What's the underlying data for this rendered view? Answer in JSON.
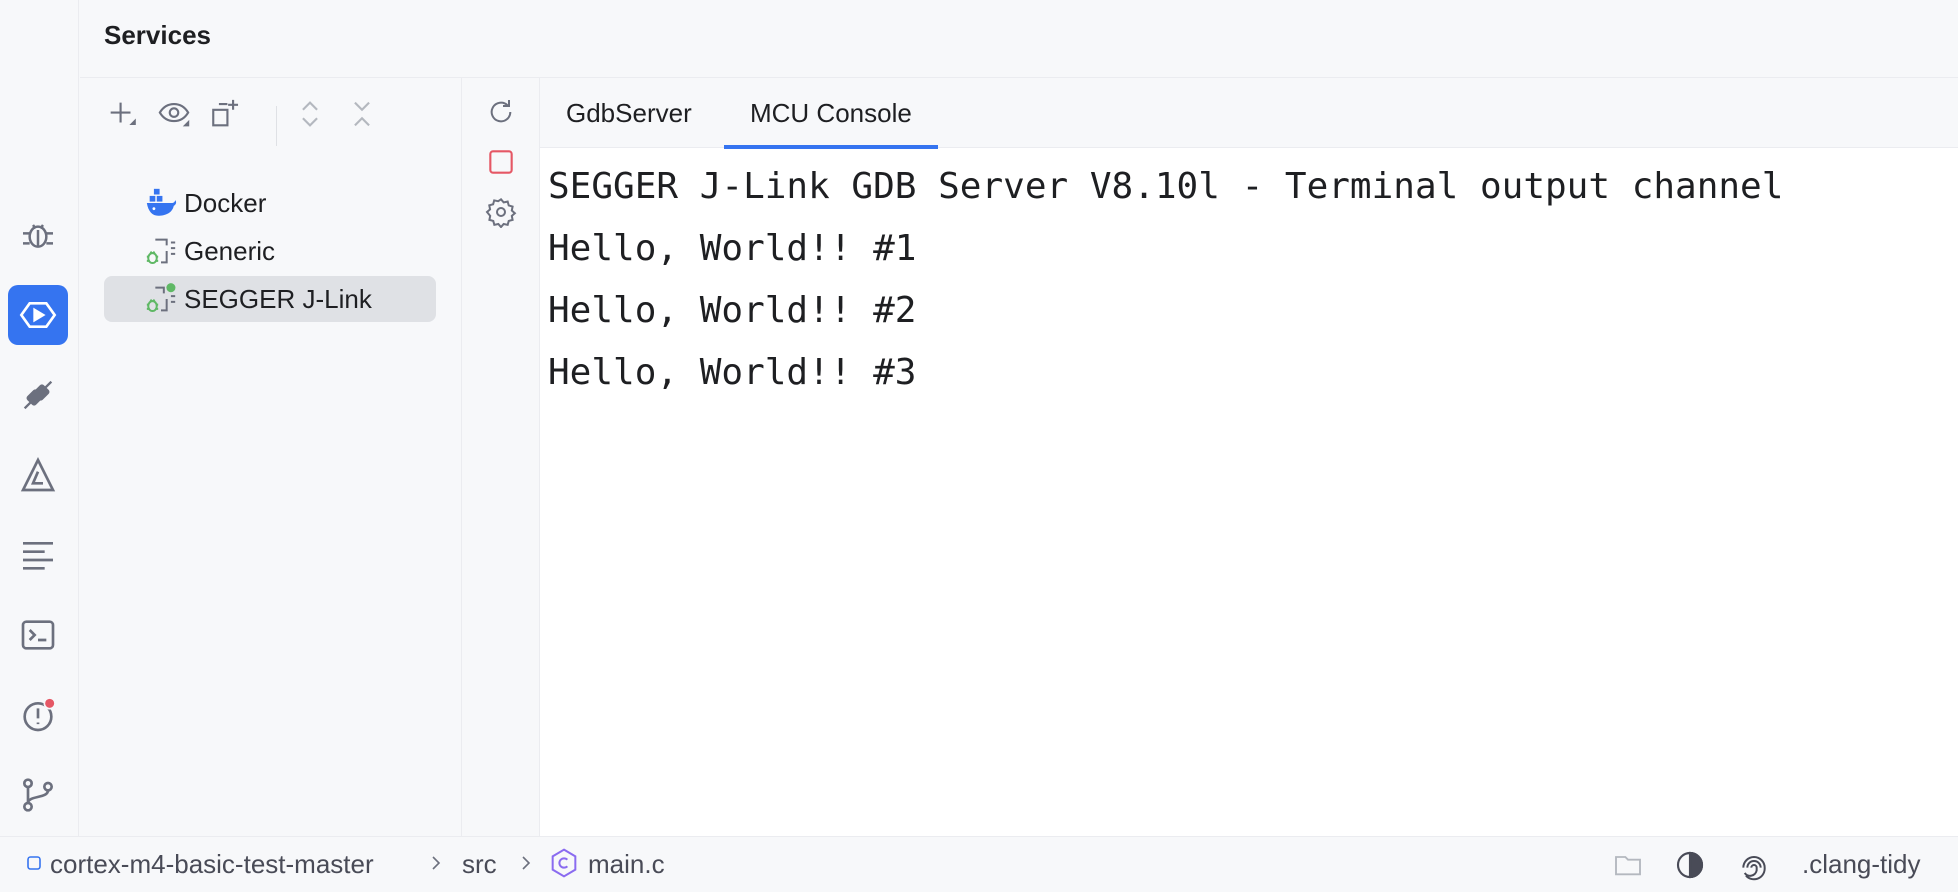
{
  "header": {
    "title": "Services"
  },
  "activity_bar": {
    "items": [
      {
        "icon": "debug-icon",
        "active": false
      },
      {
        "icon": "services-icon",
        "active": true
      },
      {
        "icon": "plug-icon",
        "active": false
      },
      {
        "icon": "build-icon",
        "active": false
      },
      {
        "icon": "structure-icon",
        "active": false
      },
      {
        "icon": "terminal-icon",
        "active": false
      },
      {
        "icon": "problems-icon",
        "active": false,
        "badge": true
      },
      {
        "icon": "git-icon",
        "active": false
      }
    ]
  },
  "tree_toolbar": {
    "icons": [
      "add-icon",
      "eye-icon",
      "new-group-icon",
      "expand-all-icon",
      "collapse-all-icon"
    ]
  },
  "tree": {
    "items": [
      {
        "label": "Docker",
        "icon": "docker-icon",
        "selected": false
      },
      {
        "label": "Generic",
        "icon": "debug-config-icon",
        "selected": false
      },
      {
        "label": "SEGGER J-Link",
        "icon": "debug-config-running-icon",
        "selected": true
      }
    ]
  },
  "actions": {
    "icons": [
      "rerun-icon",
      "stop-icon",
      "settings-icon"
    ],
    "stop_color": "#e55765"
  },
  "console": {
    "tabs": [
      {
        "label": "GdbServer",
        "active": false
      },
      {
        "label": "MCU Console",
        "active": true
      }
    ],
    "lines": [
      "SEGGER J-Link GDB Server V8.10l - Terminal output channel",
      "Hello, World!! #1",
      "Hello, World!! #2",
      "Hello, World!! #3"
    ]
  },
  "status_bar": {
    "breadcrumb": [
      "cortex-m4-basic-test-master",
      "src",
      "main.c"
    ],
    "right_label": ".clang-tidy"
  },
  "colors": {
    "accent": "#3574f0",
    "icon": "#6c707e",
    "badge": "#e55765",
    "green": "#5fb865"
  }
}
